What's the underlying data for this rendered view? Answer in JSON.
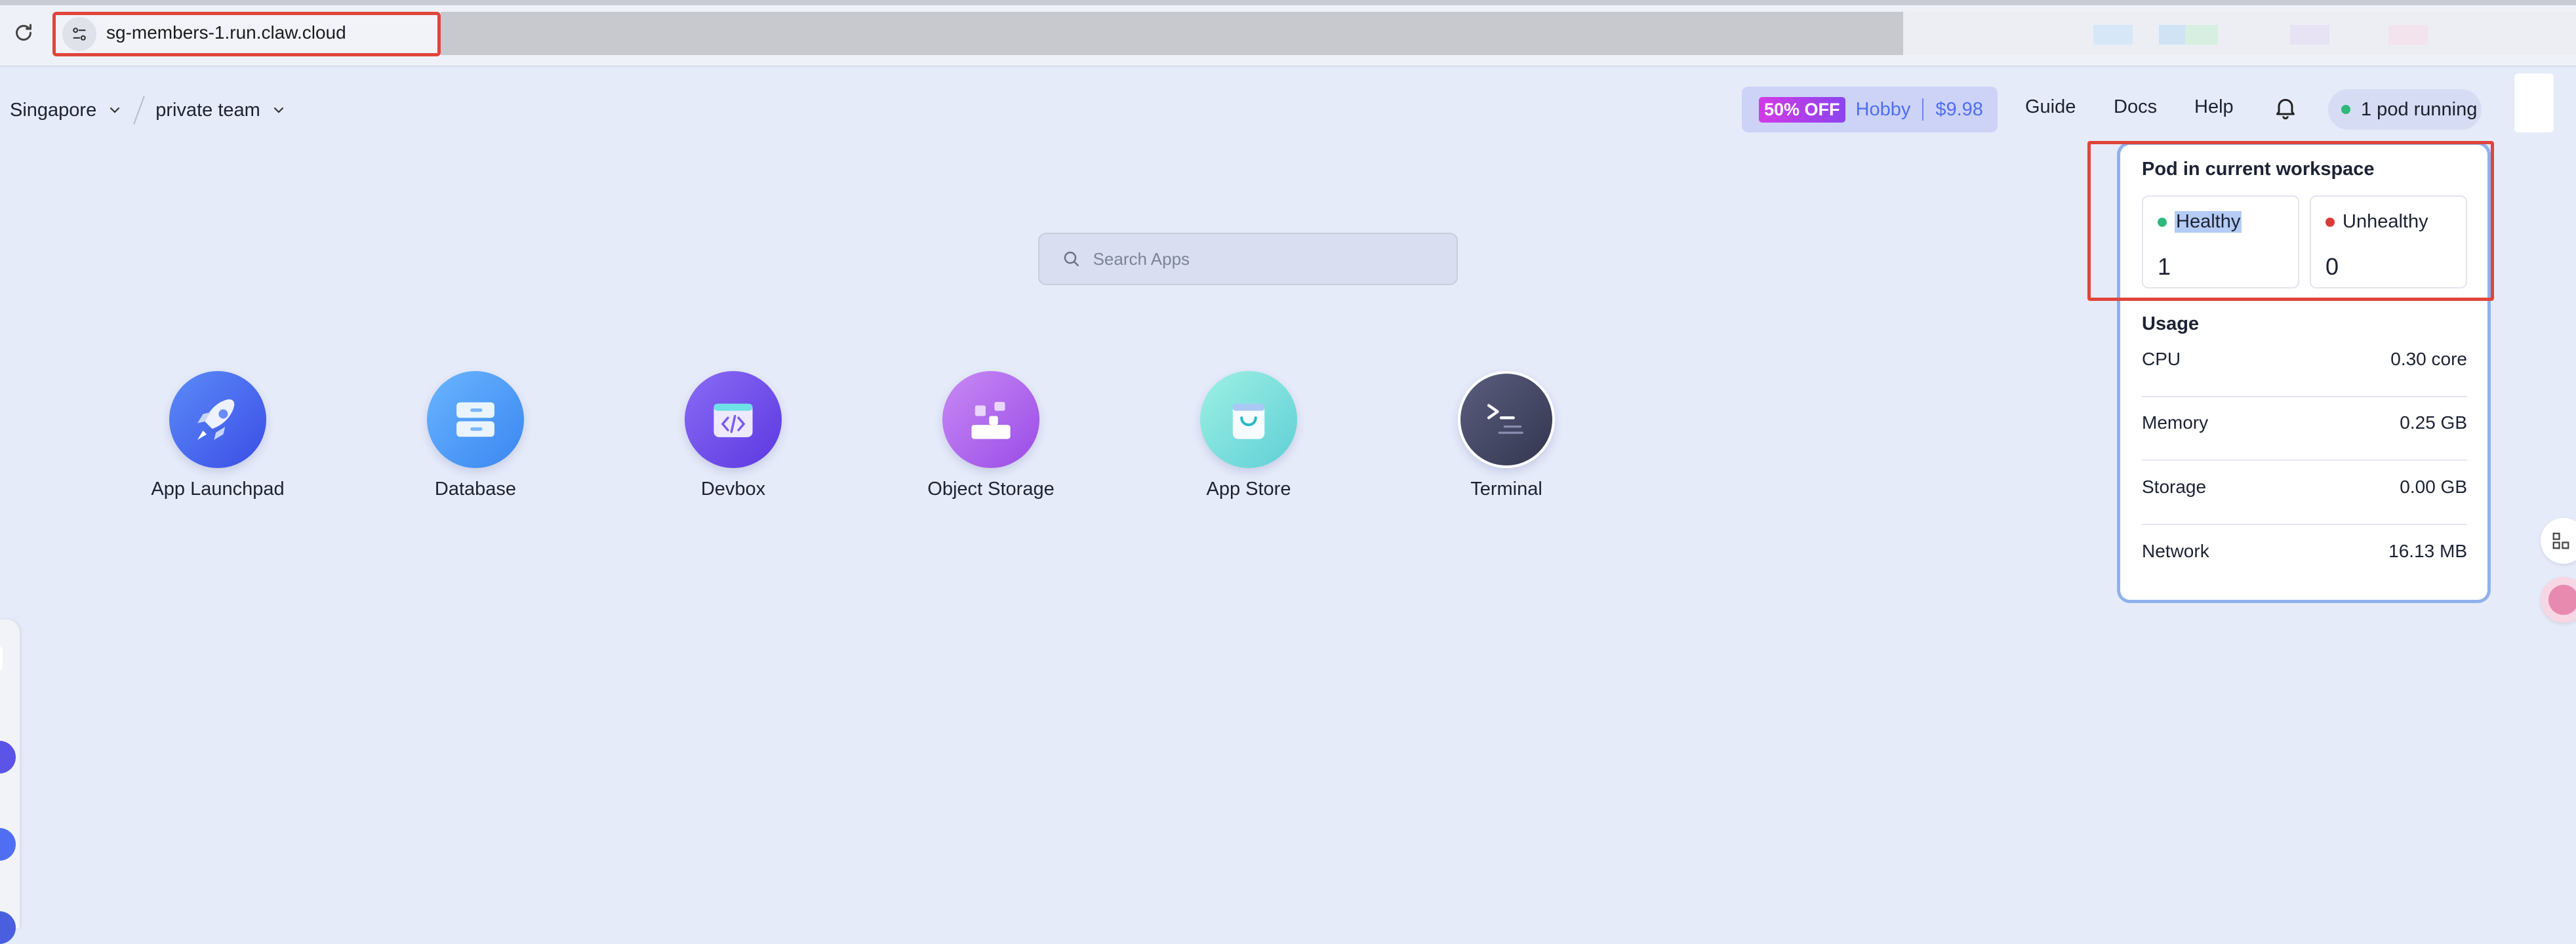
{
  "browser": {
    "url": "sg-members-1.run.claw.cloud"
  },
  "header": {
    "region": "Singapore",
    "team": "private team",
    "promo": {
      "badge": "50% OFF",
      "plan": "Hobby",
      "price": "$9.98"
    },
    "nav": [
      "Guide",
      "Docs",
      "Help"
    ],
    "pods_status": "1 pod running"
  },
  "search": {
    "placeholder": "Search Apps"
  },
  "apps": [
    {
      "label": "App Launchpad",
      "icon": "rocket-icon"
    },
    {
      "label": "Database",
      "icon": "database-icon"
    },
    {
      "label": "Devbox",
      "icon": "code-box-icon"
    },
    {
      "label": "Object Storage",
      "icon": "storage-blocks-icon"
    },
    {
      "label": "App Store",
      "icon": "shopping-bag-icon"
    },
    {
      "label": "Terminal",
      "icon": "terminal-icon"
    }
  ],
  "pod_panel": {
    "title": "Pod in current workspace",
    "healthy": {
      "label": "Healthy",
      "count": "1"
    },
    "unhealthy": {
      "label": "Unhealthy",
      "count": "0"
    },
    "usage_title": "Usage",
    "usage": [
      {
        "name": "CPU",
        "value": "0.30 core"
      },
      {
        "name": "Memory",
        "value": "0.25 GB"
      },
      {
        "name": "Storage",
        "value": "0.00 GB"
      },
      {
        "name": "Network",
        "value": "16.13 MB"
      }
    ]
  },
  "colors": {
    "background": "#e6ebfa",
    "accent": "#4f6ef2",
    "healthy": "#2eb87b",
    "unhealthy": "#d93a3a",
    "highlight": "#e0453a"
  }
}
